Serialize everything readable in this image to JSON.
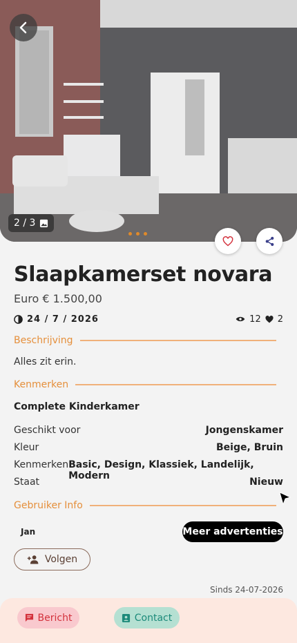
{
  "listing": {
    "title": "Slaapkamerset novara",
    "price": "Euro € 1.500,00",
    "date": "24 / 7 / 2026",
    "views": "12",
    "likes": "2"
  },
  "gallery": {
    "counter": "2 / 3",
    "dot_count": 3,
    "accent": "#e08a2a"
  },
  "sections": {
    "description_title": "Beschrijving",
    "features_title": "Kenmerken",
    "user_title": "Gebruiker Info"
  },
  "description": "Alles zit erin.",
  "feature_heading": "Complete Kinderkamer",
  "specs": [
    {
      "key": "Geschikt voor",
      "value": "Jongenskamer"
    },
    {
      "key": "Kleur",
      "value": "Beige, Bruin"
    },
    {
      "key": "Kenmerken",
      "value": "Basic, Design, Klassiek, Landelijk, Modern"
    },
    {
      "key": "Staat",
      "value": "Nieuw"
    }
  ],
  "user": {
    "name": "Jan",
    "more_label": "Meer advertenties",
    "follow_label": "Volgen",
    "since": "Sinds 24-07-2026"
  },
  "bottom": {
    "message_label": "Bericht",
    "contact_label": "Contact"
  },
  "colors": {
    "accent": "#e58f3b",
    "message": "#d3313c",
    "contact": "#1c8a7a"
  },
  "icons": [
    "back-arrow-icon",
    "image-icon",
    "heart-icon",
    "share-icon",
    "clock-icon",
    "eye-icon",
    "heart-filled-icon",
    "person-add-icon",
    "message-icon",
    "contact-icon",
    "cursor-icon"
  ]
}
